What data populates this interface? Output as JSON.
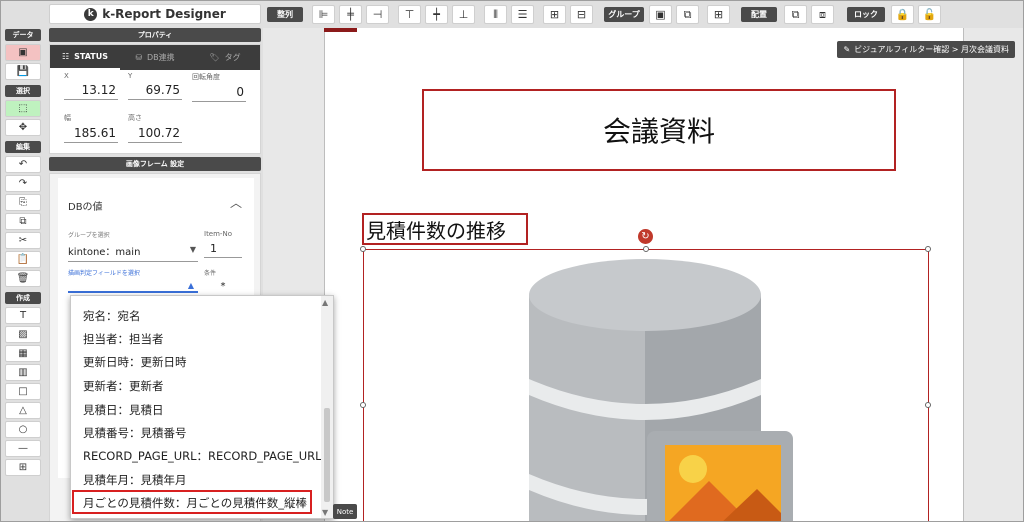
{
  "app": {
    "title": "k-Report Designer",
    "logo_letter": "k"
  },
  "toolbar": {
    "align_label": "整列",
    "group_label": "グループ",
    "arrange_label": "配置",
    "lock_label": "ロック",
    "align_icons": [
      "align-left-icon",
      "align-center-h-icon",
      "align-right-icon",
      "align-top-icon",
      "align-middle-icon",
      "align-bottom-icon",
      "distribute-h-icon",
      "distribute-v-icon"
    ],
    "grid_icons": [
      "grid-icon",
      "grid-alt-icon"
    ]
  },
  "rail": {
    "data_label": "データ",
    "select_label": "選択",
    "edit_label": "編集",
    "create_label": "作成"
  },
  "properties": {
    "header": "プロパティ",
    "tabs": [
      {
        "label": "STATUS",
        "icon": "sliders-icon"
      },
      {
        "label": "DB連携",
        "icon": "database-icon"
      },
      {
        "label": "タグ",
        "icon": "tag-icon"
      }
    ],
    "x_label": "X",
    "x_value": "13.12",
    "y_label": "Y",
    "y_value": "69.75",
    "rotation_label": "回転角度",
    "rotation_value": "0",
    "width_label": "幅",
    "width_value": "185.61",
    "height_label": "高さ",
    "height_value": "100.72"
  },
  "image_frame_settings": {
    "header": "画像フレーム 設定",
    "db_title": "DBの値",
    "group_label": "グループを選択",
    "group_value": "kintone：main",
    "item_no_label": "Item-No",
    "item_no_value": "1",
    "draw_field_label": "描画判定フィールドを選択",
    "condition_label": "条件",
    "condition_value": "*"
  },
  "dropdown": {
    "items": [
      "宛名：宛名",
      "担当者：担当者",
      "更新日時：更新日時",
      "更新者：更新者",
      "見積日：見積日",
      "見積番号：見積番号",
      "RECORD_PAGE_URL：RECORD_PAGE_URL",
      "見積年月：見積年月",
      "月ごとの見積件数：月ごとの見積件数_縦棒"
    ],
    "highlighted_index": 8
  },
  "note_tab": "Note",
  "canvas": {
    "breadcrumb": "ビジュアルフィルター確認 > 月次会議資料",
    "title": "会議資料",
    "subtitle": "見積件数の推移"
  },
  "colors": {
    "accent_red": "#b22222",
    "dark_header": "#4a4a4a",
    "focus_blue": "#3a6fd8"
  }
}
